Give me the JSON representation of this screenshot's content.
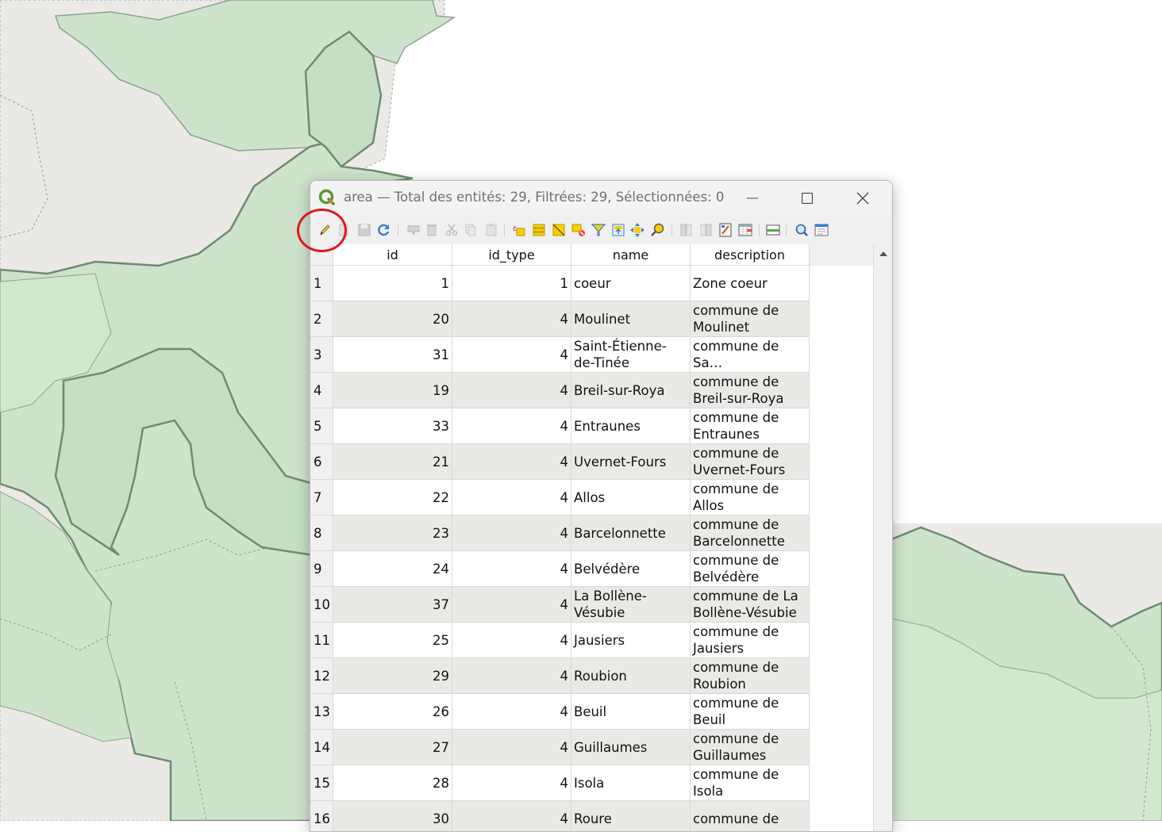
{
  "window": {
    "title": "area — Total des entités: 29, Filtrées: 29, Sélectionnées: 0"
  },
  "toolbar": {
    "buttons": [
      {
        "name": "toggle-editing-icon"
      },
      {
        "name": "multi-edit-icon"
      },
      {
        "name": "save-edits-icon"
      },
      {
        "name": "reload-table-icon"
      },
      {
        "name": "add-feature-icon"
      },
      {
        "name": "delete-feature-icon"
      },
      {
        "name": "cut-icon"
      },
      {
        "name": "copy-icon"
      },
      {
        "name": "paste-icon"
      },
      {
        "name": "select-by-expression-icon"
      },
      {
        "name": "select-all-icon"
      },
      {
        "name": "invert-selection-icon"
      },
      {
        "name": "deselect-all-icon"
      },
      {
        "name": "filter-selection-icon"
      },
      {
        "name": "move-selection-to-top-icon"
      },
      {
        "name": "pan-map-to-selection-icon"
      },
      {
        "name": "zoom-map-to-selection-icon"
      },
      {
        "name": "new-field-icon"
      },
      {
        "name": "delete-field-icon"
      },
      {
        "name": "field-calculator-icon"
      },
      {
        "name": "conditional-formatting-icon"
      },
      {
        "name": "dock-table-icon"
      },
      {
        "name": "actions-icon"
      },
      {
        "name": "form-view-icon"
      }
    ]
  },
  "table": {
    "headers": [
      "id",
      "id_type",
      "name",
      "description"
    ],
    "rows": [
      {
        "n": "1",
        "id": "1",
        "id_type": "1",
        "name": "coeur",
        "description": "Zone coeur"
      },
      {
        "n": "2",
        "id": "20",
        "id_type": "4",
        "name": "Moulinet",
        "description": "commune de Moulinet"
      },
      {
        "n": "3",
        "id": "31",
        "id_type": "4",
        "name": "Saint-Étienne-de-Tinée",
        "description": "commune de Sa…"
      },
      {
        "n": "4",
        "id": "19",
        "id_type": "4",
        "name": "Breil-sur-Roya",
        "description": "commune de Breil-sur-Roya"
      },
      {
        "n": "5",
        "id": "33",
        "id_type": "4",
        "name": "Entraunes",
        "description": "commune de Entraunes"
      },
      {
        "n": "6",
        "id": "21",
        "id_type": "4",
        "name": "Uvernet-Fours",
        "description": "commune de Uvernet-Fours"
      },
      {
        "n": "7",
        "id": "22",
        "id_type": "4",
        "name": "Allos",
        "description": "commune de Allos"
      },
      {
        "n": "8",
        "id": "23",
        "id_type": "4",
        "name": "Barcelonnette",
        "description": "commune de Barcelonnette"
      },
      {
        "n": "9",
        "id": "24",
        "id_type": "4",
        "name": "Belvédère",
        "description": "commune de Belvédère"
      },
      {
        "n": "10",
        "id": "37",
        "id_type": "4",
        "name": "La Bollène-Vésubie",
        "description": "commune de La Bollène-Vésubie"
      },
      {
        "n": "11",
        "id": "25",
        "id_type": "4",
        "name": "Jausiers",
        "description": "commune de Jausiers"
      },
      {
        "n": "12",
        "id": "29",
        "id_type": "4",
        "name": "Roubion",
        "description": "commune de Roubion"
      },
      {
        "n": "13",
        "id": "26",
        "id_type": "4",
        "name": "Beuil",
        "description": "commune de Beuil"
      },
      {
        "n": "14",
        "id": "27",
        "id_type": "4",
        "name": "Guillaumes",
        "description": "commune de Guillaumes"
      },
      {
        "n": "15",
        "id": "28",
        "id_type": "4",
        "name": "Isola",
        "description": "commune de Isola"
      },
      {
        "n": "16",
        "id": "30",
        "id_type": "4",
        "name": "Roure",
        "description": "commune de"
      }
    ]
  },
  "colors": {
    "map_green": "#cde3cb",
    "map_grey": "#ebe9e6",
    "map_border": "#6e8c6e",
    "highlight": "#e0171d"
  }
}
